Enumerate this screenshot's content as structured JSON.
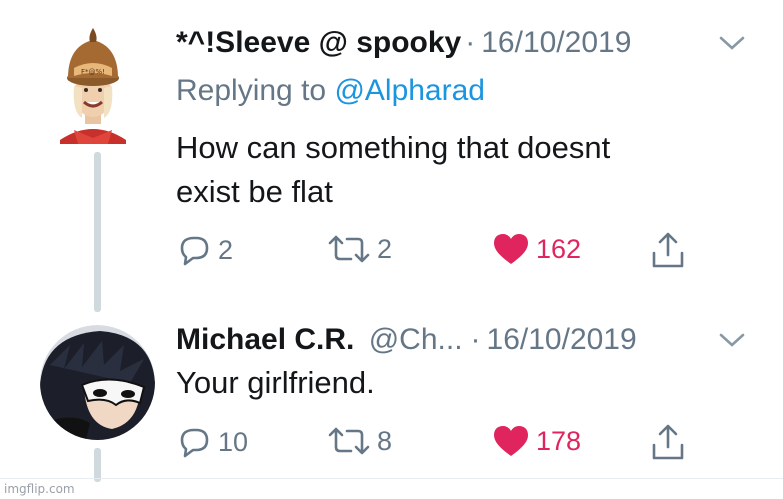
{
  "tweets": [
    {
      "display_name": "*^!Sleeve @ spooky",
      "separator": "·",
      "date": "16/10/2019",
      "reply_prefix": "Replying to ",
      "reply_mention": "@Alpharad",
      "text": "How can something that doesnt\nexist be flat",
      "replies": "2",
      "retweets": "2",
      "likes": "162",
      "avatar": "donkey-kong-hat-person"
    },
    {
      "display_name": "Michael C.R.",
      "handle": "@Ch...",
      "separator": "·",
      "date": "16/10/2019",
      "text": "Your girlfriend.",
      "replies": "10",
      "retweets": "8",
      "likes": "178",
      "avatar": "masked-character"
    }
  ],
  "watermark": "imgflip.com",
  "colors": {
    "like": "#e0245e",
    "mention": "#1b95e0",
    "muted": "#657786",
    "thread_line": "#cfd9de"
  },
  "icons": [
    "reply-icon",
    "retweet-icon",
    "heart-icon",
    "share-icon",
    "chevron-down-icon"
  ]
}
